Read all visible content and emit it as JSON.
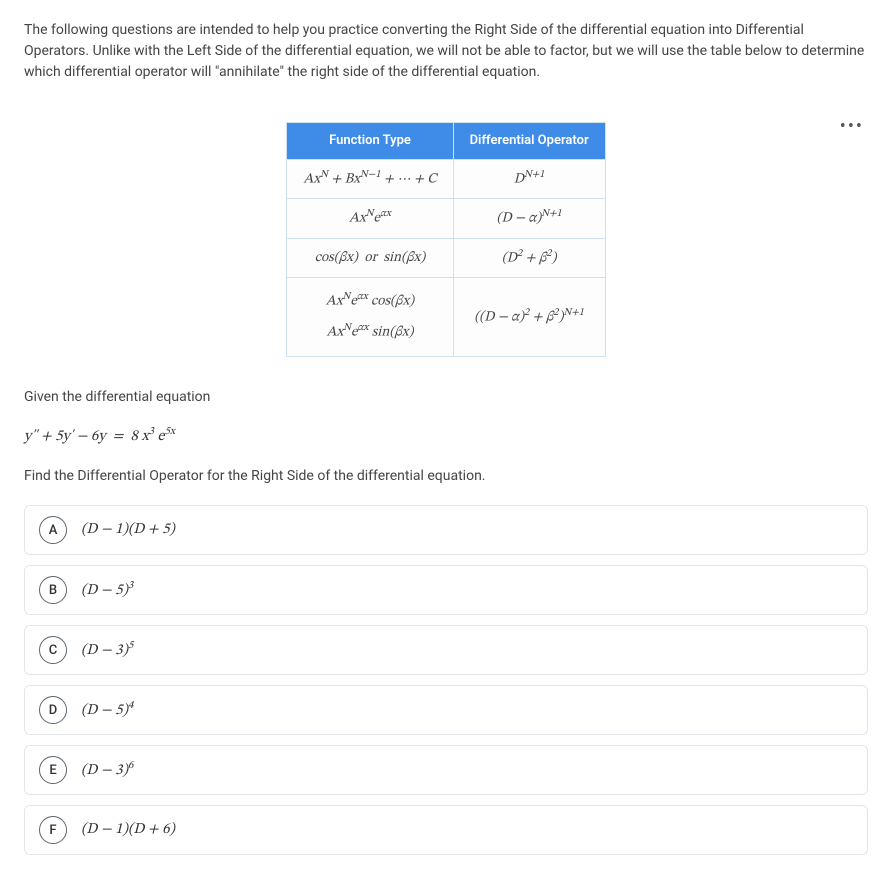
{
  "intro": "The following questions are intended to help you practice converting the Right Side of the differential equation into Differential Operators. Unlike with the Left Side of the differential equation, we will not be able to factor, but we will use the table below to determine which differential operator will \"annihilate\" the right side of the differential equation.",
  "table": {
    "headers": {
      "left": "Function Type",
      "right": "Differential Operator"
    },
    "rows": [
      {
        "func": "AxN + BxN−1 + ⋯ + C",
        "op": "DN+1"
      },
      {
        "func": "AxN eαx",
        "op": "(D − α)N+1"
      },
      {
        "func": "cos(βx)  or  sin(βx)",
        "op": "(D2 + β2)"
      },
      {
        "func_a": "AxN eαx cos(βx)",
        "func_b": "AxN eαx sin(βx)",
        "op": "((D − α)2 + β2)N+1"
      }
    ]
  },
  "given_label": "Given the differential equation",
  "equation": "y'' + 5y' − 6y  =  8 x3 e5x",
  "find_label": "Find the Differential Operator for the Right Side of the differential equation.",
  "options": [
    {
      "letter": "A",
      "text": "(D − 1)(D + 5)"
    },
    {
      "letter": "B",
      "text": "(D − 5)3"
    },
    {
      "letter": "C",
      "text": "(D − 3)5"
    },
    {
      "letter": "D",
      "text": "(D − 5)4"
    },
    {
      "letter": "E",
      "text": "(D − 3)6"
    },
    {
      "letter": "F",
      "text": "(D − 1)(D + 6)"
    }
  ]
}
